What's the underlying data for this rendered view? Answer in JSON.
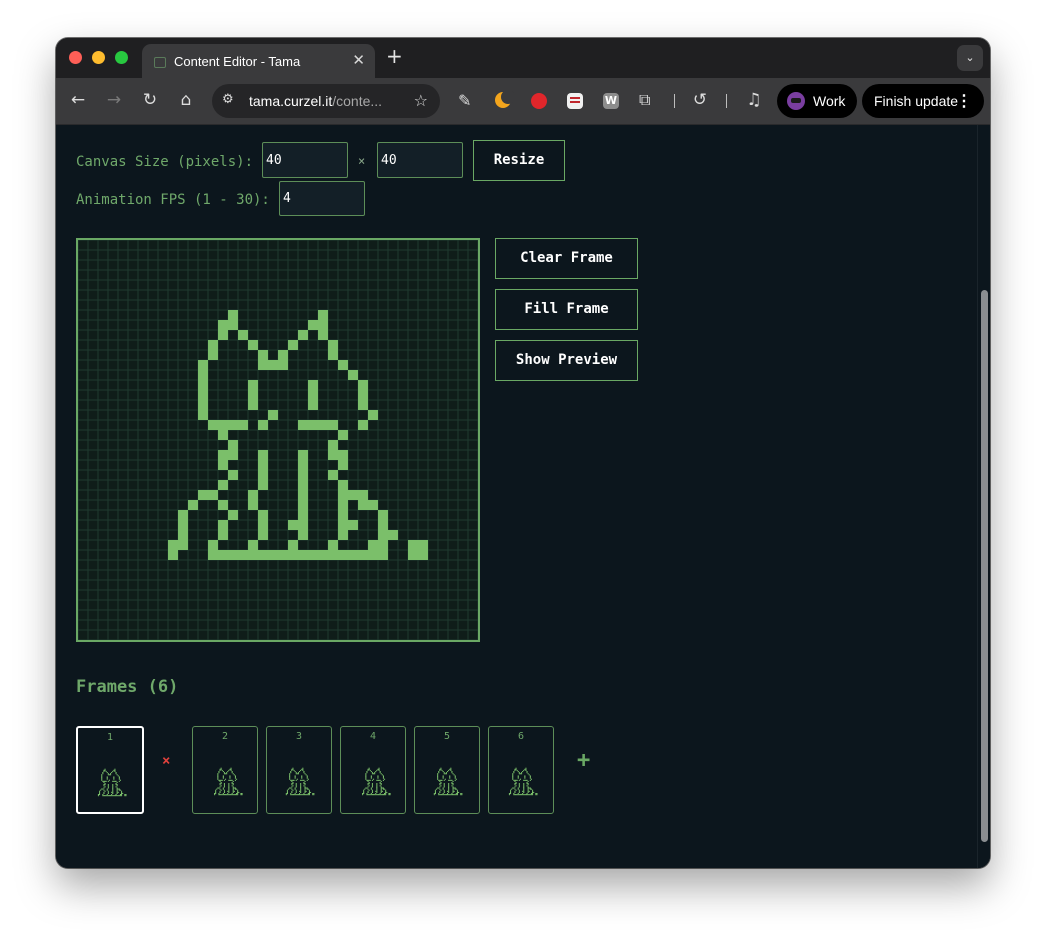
{
  "browser": {
    "tab_title": "Content Editor - Tama",
    "new_tab": "+",
    "tab_close": "✕",
    "tab_menu": "⌄",
    "url_host": "tama.curzel.it",
    "url_path": "/conte...",
    "profile_name": "Work",
    "update_label": "Finish update"
  },
  "canvas_size": {
    "label": "Canvas Size (pixels):",
    "width": "40",
    "height": "40",
    "separator": "×",
    "resize_label": "Resize"
  },
  "fps": {
    "label": "Animation FPS (1 - 30):",
    "value": "4"
  },
  "actions": {
    "clear": "Clear Frame",
    "fill": "Fill Frame",
    "preview": "Show Preview"
  },
  "frames": {
    "title": "Frames (6)",
    "delete_symbol": "×",
    "add_symbol": "+",
    "items": [
      {
        "number": "1",
        "selected": true
      },
      {
        "number": "2",
        "selected": false
      },
      {
        "number": "3",
        "selected": false
      },
      {
        "number": "4",
        "selected": false
      },
      {
        "number": "5",
        "selected": false
      },
      {
        "number": "6",
        "selected": false
      }
    ]
  },
  "colors": {
    "accent": "#6aa864",
    "pixel_on": "#7bbf6a",
    "background": "#0c161d",
    "grid": "#1f3a30",
    "delete": "#e0413c"
  },
  "icons": {
    "back": "arrow-left-icon",
    "forward": "arrow-right-icon",
    "reload": "reload-icon",
    "home": "home-icon",
    "bookmark": "star-icon"
  }
}
